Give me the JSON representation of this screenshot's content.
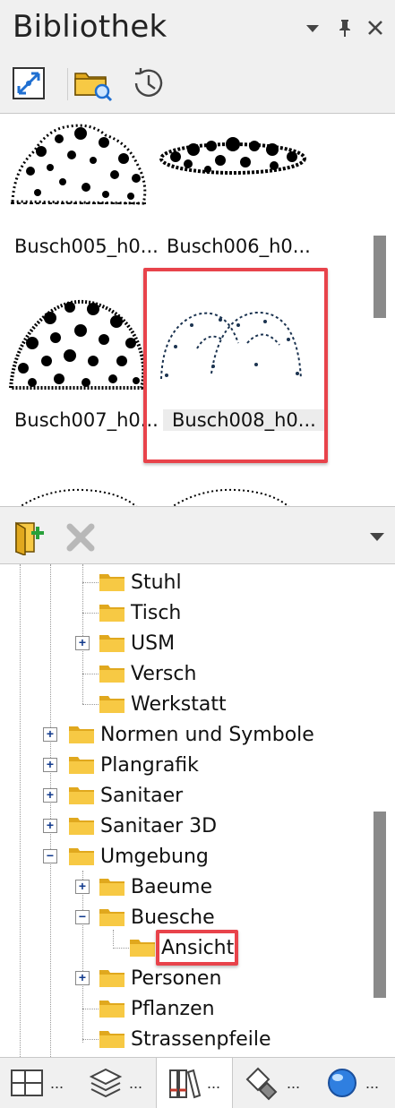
{
  "panel": {
    "title": "Bibliothek"
  },
  "thumbnails": [
    {
      "label": "Busch005_h0..."
    },
    {
      "label": "Busch006_h0..."
    },
    {
      "label": "Busch007_h0..."
    },
    {
      "label": "Busch008_h0...",
      "selected": true
    }
  ],
  "tree": {
    "items": [
      {
        "label": "Stuhl"
      },
      {
        "label": "Tisch"
      },
      {
        "label": "USM",
        "expander": "+"
      },
      {
        "label": "Versch"
      },
      {
        "label": "Werkstatt"
      },
      {
        "label": "Normen und Symbole",
        "expander": "+"
      },
      {
        "label": "Plangrafik",
        "expander": "+"
      },
      {
        "label": "Sanitaer",
        "expander": "+"
      },
      {
        "label": "Sanitaer 3D",
        "expander": "+"
      },
      {
        "label": "Umgebung",
        "expander": "−"
      },
      {
        "label": "Baeume",
        "expander": "+"
      },
      {
        "label": "Buesche",
        "expander": "−"
      },
      {
        "label": "Ansicht",
        "selected": true
      },
      {
        "label": "Personen",
        "expander": "+"
      },
      {
        "label": "Pflanzen"
      },
      {
        "label": "Strassenpfeile"
      }
    ]
  },
  "tabs": [
    {
      "dots": "..."
    },
    {
      "dots": "..."
    },
    {
      "dots": "...",
      "active": true
    },
    {
      "dots": "..."
    },
    {
      "dots": "..."
    }
  ],
  "colors": {
    "highlight": "#e8434b",
    "folder": "#f7c944",
    "folderDark": "#e0a81e",
    "scrollbar": "#8a8a8a"
  }
}
